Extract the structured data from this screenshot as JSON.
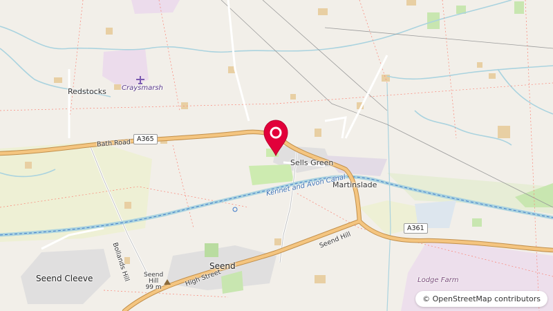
{
  "places": {
    "redstocks": "Redstocks",
    "craysmarsh": "Craysmarsh",
    "sells_green": "Sells Green",
    "martinslade": "Martinslade",
    "seend": "Seend",
    "seend_cleeve": "Seend Cleeve",
    "seend_hill_name": "Seend",
    "seend_hill_name2": "Hill",
    "seend_hill_height": "99 m",
    "lodge_farm": "Lodge Farm"
  },
  "roads": {
    "bath_road": "Bath Road",
    "a365": "A365",
    "a361": "A361",
    "seend_hill": "Seend Hill",
    "high_street": "High Street",
    "bollands_hill": "Bollands Hill"
  },
  "waterways": {
    "canal": "Kennet and Avon Canal"
  },
  "marker": {
    "icon": "map-pin-icon",
    "color": "#e2003a"
  },
  "attribution": "© OpenStreetMap contributors",
  "colors": {
    "background": "#f2efe9",
    "primary_road": "#f4c580",
    "canal": "#aad3df",
    "farmland": "#eef0d5",
    "residential": "#e0dfdf"
  }
}
